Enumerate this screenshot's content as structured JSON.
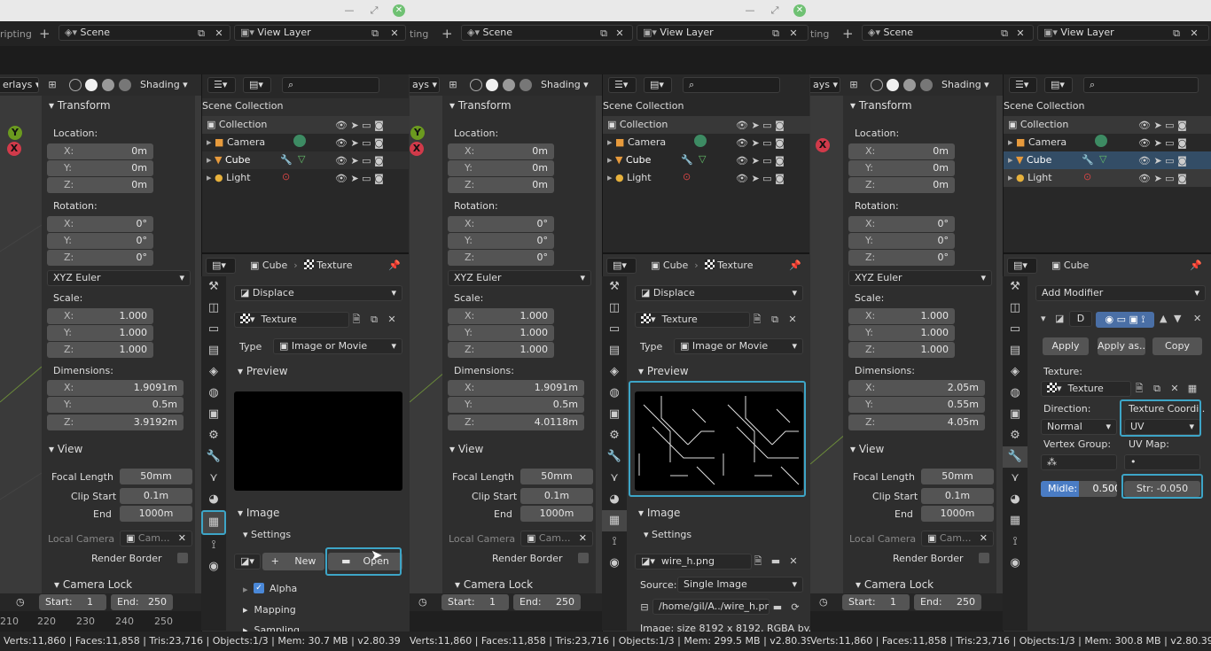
{
  "win": [
    {
      "title_clip": "ripting",
      "fragment_left": "erlays"
    },
    {
      "title_clip": "ting",
      "fragment_left": "ays"
    },
    {
      "title_clip": "ting",
      "fragment_left": "ays"
    }
  ],
  "common": {
    "scene": "Scene",
    "view_layer": "View Layer",
    "shading": "Shading",
    "transform": "Transform",
    "location": "Location:",
    "rotation": "Rotation:",
    "scale": "Scale:",
    "dimensions": "Dimensions:",
    "x": "X:",
    "y": "Y:",
    "z": "Z:",
    "zero_m": "0m",
    "zero_deg": "0°",
    "euler": "XYZ Euler",
    "one": "1.000",
    "view": "View",
    "focal": "Focal Length",
    "focal_v": "50mm",
    "clip_start": "Clip Start",
    "clip_start_v": "0.1m",
    "end": "End",
    "end_v": "1000m",
    "local_camera": "Local Camera",
    "cam_short": "Cam...",
    "render_border": "Render Border",
    "camera_lock": "Camera Lock",
    "start": "Start:",
    "start_v": "1",
    "end_f": "End:",
    "end_f_v": "250",
    "ticks": [
      "210",
      "220",
      "230",
      "240",
      "250"
    ],
    "scene_collection": "Scene Collection",
    "collection": "Collection",
    "camera": "Camera",
    "cube": "Cube",
    "light": "Light",
    "texture": "Texture",
    "displace": "Displace",
    "type": "Type",
    "image_or_movie": "Image or Movie",
    "preview": "Preview",
    "image": "Image",
    "settings": "Settings",
    "new": "New",
    "open": "Open",
    "alpha": "Alpha",
    "mapping": "Mapping",
    "sampling": "Sampling",
    "status_base": "Verts:11,860 | Faces:11,858 | Tris:23,716 | Objects:1/3 | Mem: ",
    "version": " | v2.80.39",
    "axis_y": "Y",
    "axis_x": "X"
  },
  "w1": {
    "dim_x": "1.9091m",
    "dim_y": "0.5m",
    "dim_z": "3.9192m",
    "mem": "30.7 MB"
  },
  "w2": {
    "dim_x": "1.9091m",
    "dim_y": "0.5m",
    "dim_z": "4.0118m",
    "mem": "299.5 MB",
    "img_name": "wire_h.png",
    "source": "Source:",
    "source_v": "Single Image",
    "path": "/home/gil/A../wire_h.png",
    "img_info": "Image: size 8192 x 8192, RGBA by..."
  },
  "w3": {
    "dim_x": "2.05m",
    "dim_y": "0.55m",
    "dim_z": "4.05m",
    "mem": "300.8 MB",
    "add_modifier": "Add Modifier",
    "mod_letter": "D",
    "apply": "Apply",
    "apply_as": "Apply as..",
    "copy": "Copy",
    "texture_label": "Texture:",
    "direction": "Direction:",
    "tex_coords": "Texture Coordi..",
    "normal": "Normal",
    "uv": "UV",
    "vertex_group": "Vertex Group:",
    "uv_map": "UV Map:",
    "uv_map_v": "•",
    "midlevel": "Midle:",
    "midlevel_v": "0.500",
    "strength": "Str: -0.050"
  }
}
